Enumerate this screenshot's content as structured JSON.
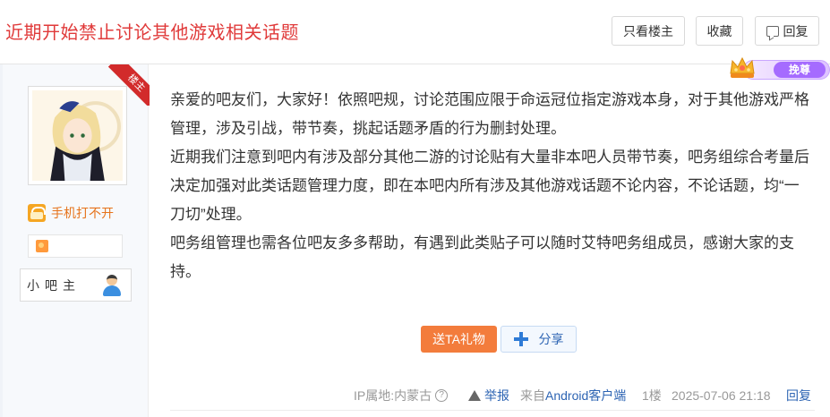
{
  "header": {
    "title": "近期开始禁止讨论其他游戏相关话题",
    "only_owner_label": "只看楼主",
    "favorite_label": "收藏",
    "reply_label": "回复"
  },
  "author": {
    "floor_badge": "楼主",
    "vip_text": "手机打不开",
    "role": "小吧主"
  },
  "vip_badge": {
    "tag": "挽尊"
  },
  "post": {
    "paragraphs": [
      "亲爱的吧友们，大家好！依照吧规，讨论范围应限于命运冠位指定游戏本身，对于其他游戏严格管理，涉及引战，带节奏，挑起话题矛盾的行为删封处理。",
      "近期我们注意到吧内有涉及部分其他二游的讨论贴有大量非本吧人员带节奏，吧务组综合考量后决定加强对此类话题管理力度，即在本吧内所有涉及其他游戏话题不论内容，不论话题，均“一刀切”处理。",
      "吧务组管理也需各位吧友多多帮助，有遇到此类贴子可以随时艾特吧务组成员，感谢大家的支持。"
    ]
  },
  "actions": {
    "gift_label": "送TA礼物",
    "share_label": "分享"
  },
  "meta": {
    "ip_location": "IP属地:内蒙古",
    "report_label": "举报",
    "from_prefix": "来自",
    "from_client": "Android客户端",
    "floor": "1楼",
    "time": "2025-07-06 21:18",
    "reply_label": "回复"
  },
  "colors": {
    "title": "#e03a3a",
    "link": "#2d64b3",
    "gift": "#f37c3c",
    "floor_ribbon": "#d22b2b"
  }
}
